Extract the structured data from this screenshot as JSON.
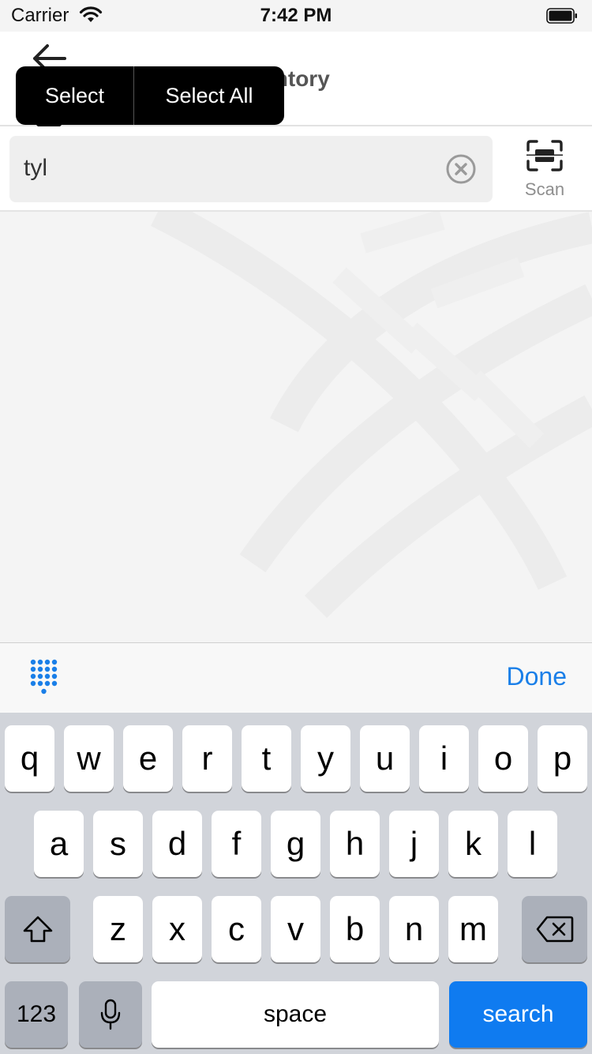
{
  "status_bar": {
    "carrier": "Carrier",
    "time": "7:42 PM"
  },
  "header": {
    "title": "entory"
  },
  "popup": {
    "select": "Select",
    "select_all": "Select All"
  },
  "search": {
    "value": "tyl"
  },
  "scan": {
    "label": "Scan"
  },
  "accessory": {
    "done": "Done"
  },
  "keyboard": {
    "row1": [
      "q",
      "w",
      "e",
      "r",
      "t",
      "y",
      "u",
      "i",
      "o",
      "p"
    ],
    "row2": [
      "a",
      "s",
      "d",
      "f",
      "g",
      "h",
      "j",
      "k",
      "l"
    ],
    "row3": [
      "z",
      "x",
      "c",
      "v",
      "b",
      "n",
      "m"
    ],
    "numbers": "123",
    "space": "space",
    "search": "search"
  },
  "colors": {
    "accent": "#1a7fe8",
    "search_key": "#0f7bf0"
  }
}
